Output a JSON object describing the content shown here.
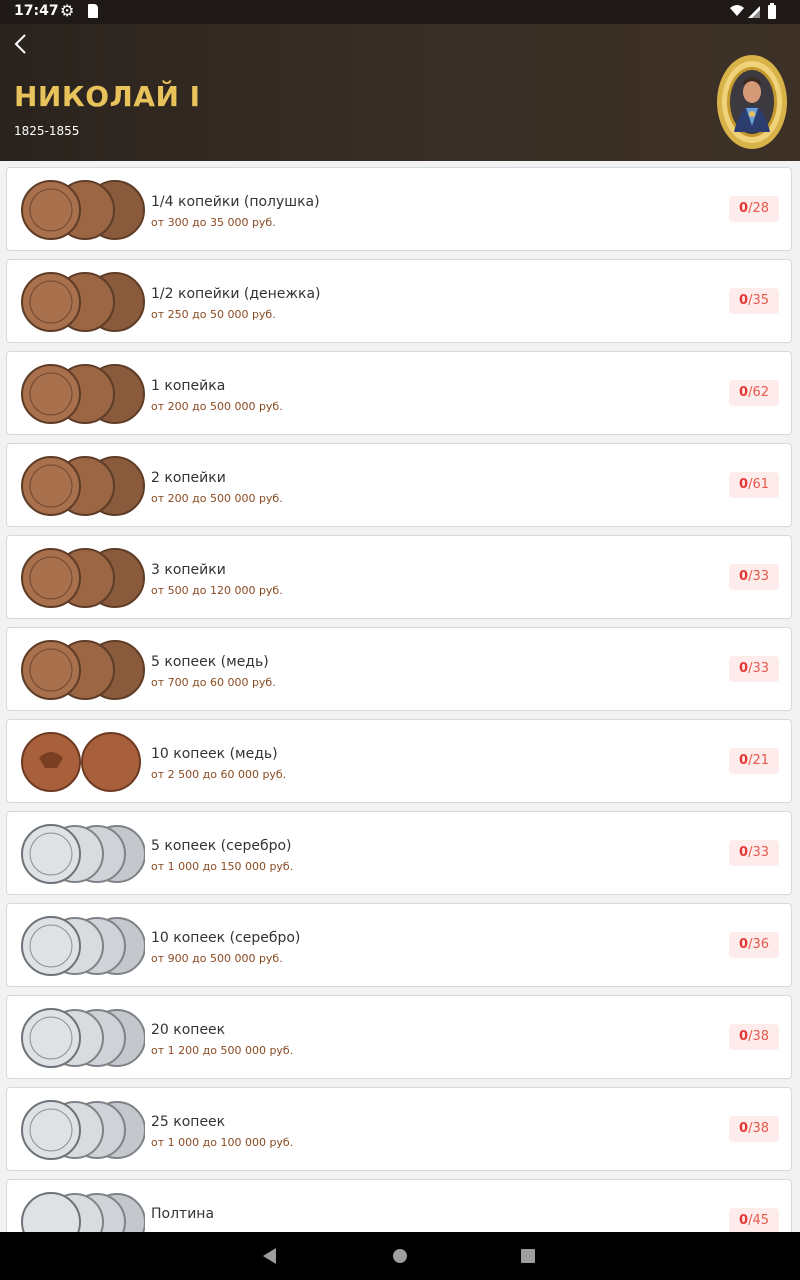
{
  "status_bar": {
    "time": "17:47"
  },
  "header": {
    "title": "НИКОЛАЙ I",
    "years": "1825-1855"
  },
  "items": [
    {
      "name": "1/4 копейки (полушка)",
      "price": "от 300 до 35 000 руб.",
      "owned": "0",
      "total": "/28",
      "metal": "copper"
    },
    {
      "name": "1/2 копейки (денежка)",
      "price": "от 250 до 50 000 руб.",
      "owned": "0",
      "total": "/35",
      "metal": "copper"
    },
    {
      "name": "1 копейка",
      "price": "от 200 до 500 000 руб.",
      "owned": "0",
      "total": "/62",
      "metal": "copper"
    },
    {
      "name": "2 копейки",
      "price": "от 200 до 500 000 руб.",
      "owned": "0",
      "total": "/61",
      "metal": "copper"
    },
    {
      "name": "3 копейки",
      "price": "от 500 до 120 000 руб.",
      "owned": "0",
      "total": "/33",
      "metal": "copper"
    },
    {
      "name": "5 копеек (медь)",
      "price": "от 700 до 60 000 руб.",
      "owned": "0",
      "total": "/33",
      "metal": "copper"
    },
    {
      "name": "10 копеек (медь)",
      "price": "от 2 500 до 60 000 руб.",
      "owned": "0",
      "total": "/21",
      "metal": "copper"
    },
    {
      "name": "5 копеек (серебро)",
      "price": "от 1 000 до 150 000 руб.",
      "owned": "0",
      "total": "/33",
      "metal": "silver"
    },
    {
      "name": "10 копеек (серебро)",
      "price": "от 900 до 500 000 руб.",
      "owned": "0",
      "total": "/36",
      "metal": "silver"
    },
    {
      "name": "20 копеек",
      "price": "от 1 200 до 500 000 руб.",
      "owned": "0",
      "total": "/38",
      "metal": "silver"
    },
    {
      "name": "25 копеек",
      "price": "от 1 000 до 100 000 руб.",
      "owned": "0",
      "total": "/38",
      "metal": "silver"
    },
    {
      "name": "Полтина",
      "price": "",
      "owned": "0",
      "total": "/45",
      "metal": "silver"
    }
  ],
  "colors": {
    "accent_gold": "#e8c25a",
    "header_bg": "#2a231d",
    "badge_bg": "#fdeceb",
    "badge_text": "#e53935",
    "price_text": "#8a4b22"
  }
}
